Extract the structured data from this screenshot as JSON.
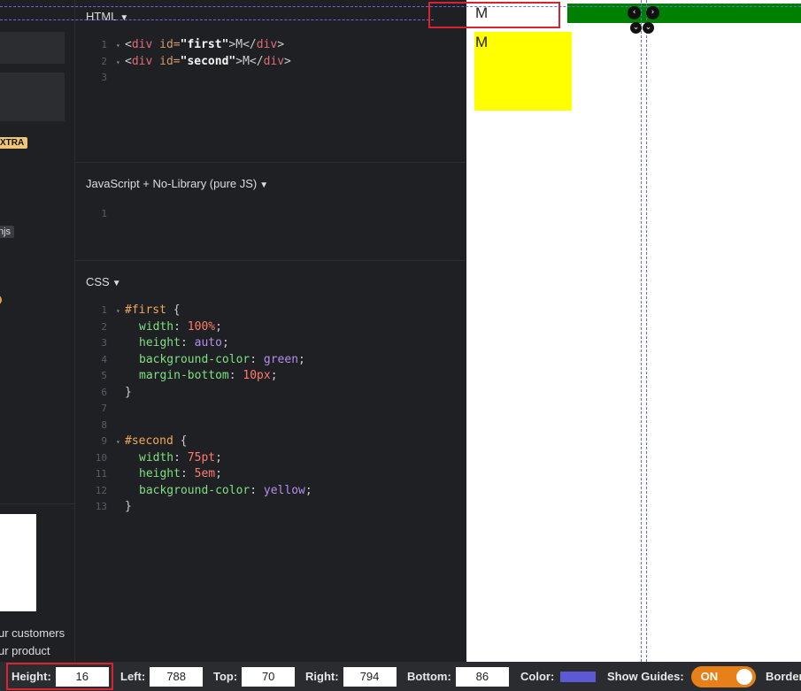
{
  "sidebar": {
    "badge": "XTRA",
    "tag": "njs",
    "text_lines": [
      "ur customers",
      "ur product"
    ]
  },
  "html_panel": {
    "title": "HTML",
    "lines": [
      {
        "n": "1",
        "open": "<",
        "tag": "div",
        "attr": " id=",
        "value": "\"first\"",
        "close": ">M</",
        "tag2": "div",
        "end": ">"
      },
      {
        "n": "2",
        "open": "<",
        "tag": "div",
        "attr": " id=",
        "value": "\"second\"",
        "close": ">M</",
        "tag2": "div",
        "end": ">"
      },
      {
        "n": "3"
      }
    ]
  },
  "js_panel": {
    "title": "JavaScript + No-Library (pure JS)",
    "lines": [
      {
        "n": "1"
      }
    ]
  },
  "css_panel": {
    "title": "CSS",
    "line_numbers": [
      "1",
      "2",
      "3",
      "4",
      "5",
      "6",
      "7",
      "8",
      "9",
      "10",
      "11",
      "12",
      "13"
    ],
    "rules": [
      {
        "selector": "#first",
        "decls": [
          {
            "prop": "width",
            "value": "100%",
            "kind": "num"
          },
          {
            "prop": "height",
            "value": "auto",
            "kind": "kw"
          },
          {
            "prop": "background-color",
            "value": "green",
            "kind": "kw"
          },
          {
            "prop": "margin-bottom",
            "value": "10px",
            "kind": "num"
          }
        ]
      },
      {
        "selector": "#second",
        "decls": [
          {
            "prop": "width",
            "value": "75pt",
            "kind": "num"
          },
          {
            "prop": "height",
            "value": "5em",
            "kind": "num"
          },
          {
            "prop": "background-color",
            "value": "yellow",
            "kind": "kw"
          }
        ]
      }
    ]
  },
  "preview": {
    "first_text": "M",
    "second_text": "M"
  },
  "toolbar": {
    "height_label": "Height:",
    "height_value": "16",
    "left_label": "Left:",
    "left_value": "788",
    "top_label": "Top:",
    "top_value": "70",
    "right_label": "Right:",
    "right_value": "794",
    "bottom_label": "Bottom:",
    "bottom_value": "86",
    "color_label": "Color:",
    "color_value": "#5b59d4",
    "guides_label": "Show Guides:",
    "guides_state": "ON",
    "border_label": "Border"
  },
  "colors": {
    "accent": "#e8801a",
    "selection": "#d9232e",
    "guide": "#6b6bd6"
  }
}
